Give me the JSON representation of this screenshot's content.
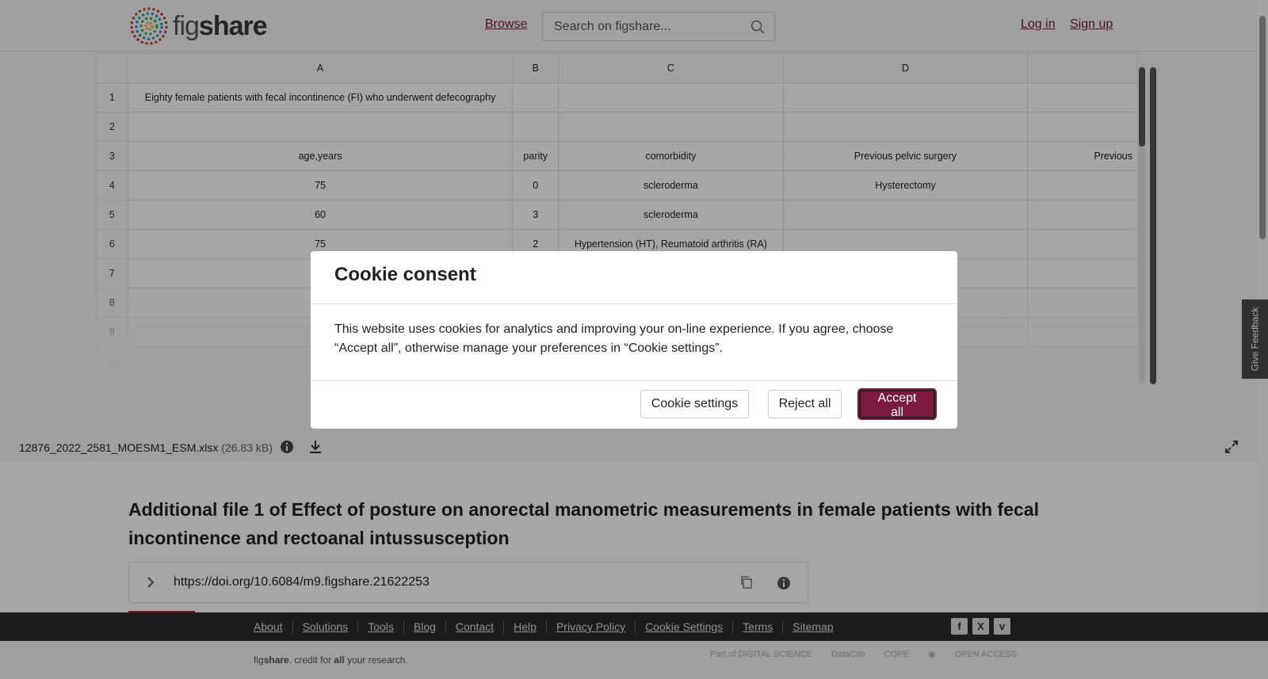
{
  "header": {
    "logo_text_light": "fig",
    "logo_text_bold": "share",
    "browse": "Browse",
    "search_placeholder": "Search on figshare...",
    "login": "Log in",
    "signup": "Sign up"
  },
  "sheet": {
    "columns": [
      "A",
      "B",
      "C",
      "D",
      ""
    ],
    "rows": [
      {
        "n": "1",
        "cells": [
          "Eighty female patients with fecal incontinence (FI) who underwent defecography",
          "",
          "",
          "",
          ""
        ]
      },
      {
        "n": "2",
        "cells": [
          "",
          "",
          "",
          "",
          ""
        ]
      },
      {
        "n": "3",
        "cells": [
          "age,years",
          "parity",
          "comorbidity",
          "Previous pelvic surgery",
          "Previous"
        ]
      },
      {
        "n": "4",
        "cells": [
          "75",
          "0",
          "scleroderma",
          "Hysterectomy",
          ""
        ]
      },
      {
        "n": "5",
        "cells": [
          "60",
          "3",
          "scleroderma",
          "",
          ""
        ]
      },
      {
        "n": "6",
        "cells": [
          "75",
          "2",
          "Hypertension (HT), Reumatoid arthritis (RA)",
          "",
          ""
        ]
      },
      {
        "n": "7",
        "cells": [
          "",
          "",
          "",
          "",
          ""
        ]
      },
      {
        "n": "8",
        "cells": [
          "",
          "",
          "",
          "",
          ""
        ]
      },
      {
        "n": "9",
        "cells": [
          "",
          "",
          "",
          "",
          ""
        ]
      },
      {
        "n": "10",
        "cells": [
          "",
          "",
          "",
          "",
          ""
        ]
      },
      {
        "n": "11",
        "cells": [
          "",
          "",
          "",
          "",
          ""
        ]
      }
    ]
  },
  "file": {
    "name": "12876_2022_2581_MOESM1_ESM.xlsx",
    "size": "(26.83 kB)"
  },
  "content": {
    "title": "Additional file 1 of Effect of posture on anorectal manometric measurements in female patients with fecal incontinence and rectoanal intussusception",
    "doi": "https://doi.org/10.6084/m9.figshare.21622253"
  },
  "feedback": "Give Feedback",
  "footer": {
    "links": [
      "About",
      "Solutions",
      "Tools",
      "Blog",
      "Contact",
      "Help",
      "Privacy Policy",
      "Cookie Settings",
      "Terms",
      "Sitemap"
    ],
    "social": [
      "f",
      "X",
      "v"
    ],
    "tagline_light": "fig",
    "tagline_bold": "share",
    "tagline_rest1": ". credit for ",
    "tagline_bold2": "all",
    "tagline_rest2": " your research.",
    "partners": [
      "Part of DIGITAL SCIENCE",
      "DataCite",
      "COPE",
      "",
      "OPEN ACCESS"
    ]
  },
  "modal": {
    "title": "Cookie consent",
    "body": "This website uses cookies for analytics and improving your on-line experience. If you agree, choose “Accept all”, otherwise manage your preferences in “Cookie settings”.",
    "settings_label": "Cookie settings",
    "reject_label": "Reject all",
    "accept_label": "Accept all"
  },
  "colors": {
    "brand": "#7b1a3f",
    "accent_red": "#b3262f"
  }
}
